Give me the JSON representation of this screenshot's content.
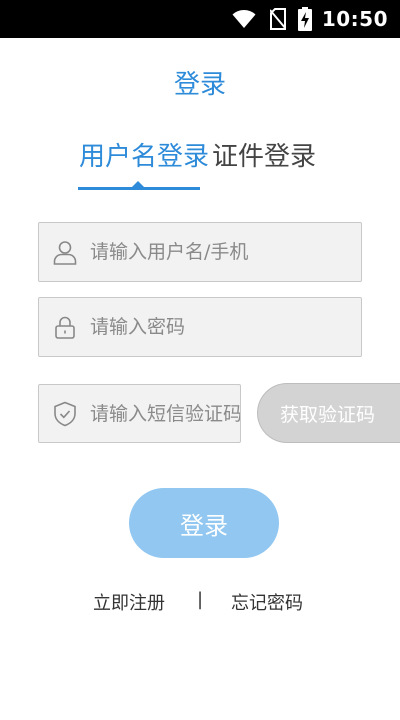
{
  "status_bar": {
    "time": "10:50"
  },
  "page": {
    "title": "登录"
  },
  "tabs": [
    {
      "label": "用户名登录",
      "active": true
    },
    {
      "label": "证件登录",
      "active": false
    }
  ],
  "form": {
    "username": {
      "placeholder": "请输入用户名/手机",
      "value": ""
    },
    "password": {
      "placeholder": "请输入密码",
      "value": ""
    },
    "sms_code": {
      "placeholder": "请输入短信验证码",
      "value": ""
    },
    "sms_button_label": "获取验证码",
    "login_button_label": "登录"
  },
  "links": {
    "register": "立即注册",
    "separator": "|",
    "forgot_password": "忘记密码"
  },
  "colors": {
    "accent": "#2e8bd9",
    "login_button": "#91c7f0",
    "sms_button_disabled": "#d3d3d3",
    "input_background": "#f2f2f2",
    "status_bar": "#000000"
  },
  "icons": {
    "username": "user-icon",
    "password": "lock-icon",
    "sms_code": "shield-check-icon",
    "status": [
      "wifi-icon",
      "no-sim-icon",
      "battery-charging-icon"
    ]
  }
}
